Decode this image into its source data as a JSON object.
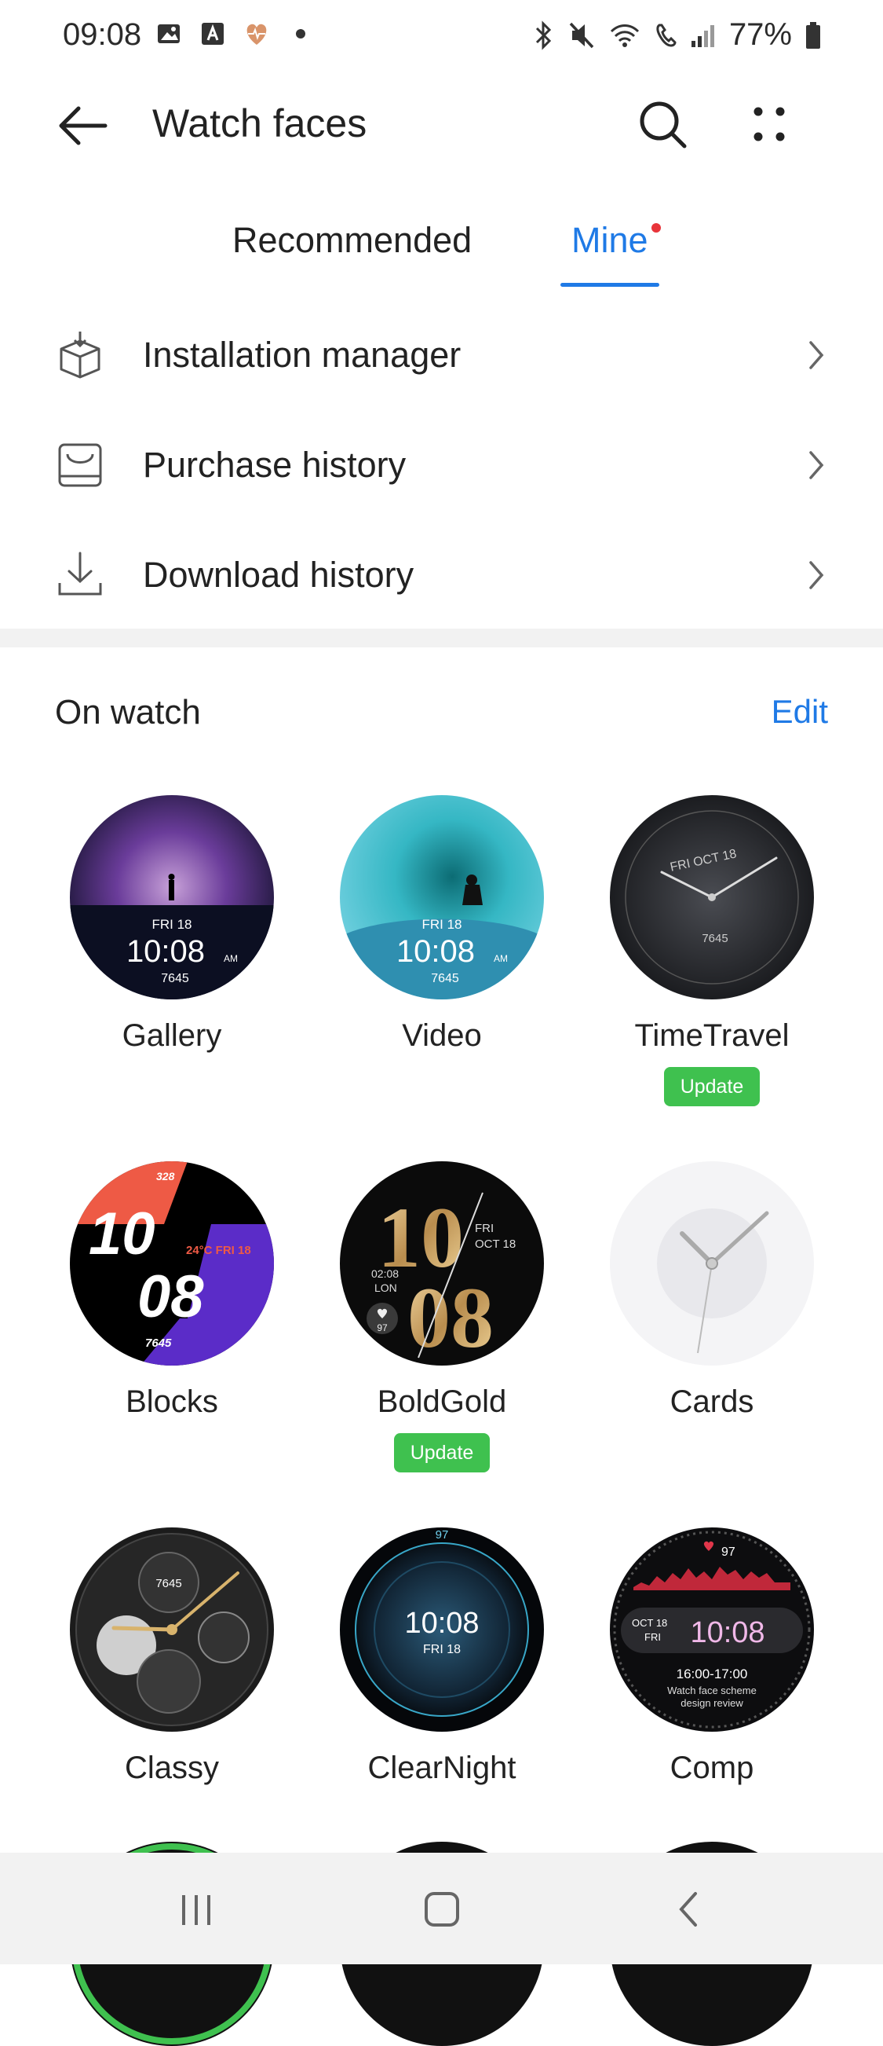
{
  "status_bar": {
    "time": "09:08",
    "battery": "77%",
    "left_icons": [
      "gallery-icon",
      "a-icon",
      "heart-icon",
      "dot-icon"
    ],
    "right_icons": [
      "bluetooth-icon",
      "mute-icon",
      "wifi-icon",
      "call-icon",
      "signal-icon",
      "battery-icon"
    ]
  },
  "app_bar": {
    "title": "Watch faces"
  },
  "tabs": [
    {
      "label": "Recommended",
      "selected": false
    },
    {
      "label": "Mine",
      "selected": true,
      "badge": true
    }
  ],
  "menu": [
    {
      "label": "Installation manager",
      "icon": "package-icon"
    },
    {
      "label": "Purchase history",
      "icon": "purchase-icon"
    },
    {
      "label": "Download history",
      "icon": "download-icon"
    }
  ],
  "on_watch": {
    "title": "On watch",
    "edit_label": "Edit",
    "update_label": "Update",
    "faces": [
      {
        "name": "Gallery",
        "date": "FRI 18",
        "time": "10:08",
        "ampm": "AM",
        "steps": "7645",
        "update": false
      },
      {
        "name": "Video",
        "date": "FRI 18",
        "time": "10:08",
        "ampm": "AM",
        "steps": "7645",
        "update": false
      },
      {
        "name": "TimeTravel",
        "date": "FRI OCT 18",
        "steps": "7645",
        "update": true
      },
      {
        "name": "Blocks",
        "hour": "10",
        "minute": "08",
        "calories": "328",
        "weather": "24°C FRI 18",
        "steps": "7645",
        "update": false
      },
      {
        "name": "BoldGold",
        "hour": "10",
        "minute": "08",
        "date_day": "FRI",
        "date": "OCT 18",
        "world_time": "02:08",
        "city": "LON",
        "heart": "97",
        "update": true
      },
      {
        "name": "Cards",
        "update": false
      },
      {
        "name": "Classy",
        "steps": "7645",
        "update": false
      },
      {
        "name": "ClearNight",
        "time": "10:08",
        "date": "FRI 18",
        "heart": "97",
        "update": false
      },
      {
        "name": "Comp",
        "time": "10:08",
        "date": "OCT 18",
        "day": "FRI",
        "heart": "97",
        "event_time": "16:00-17:00",
        "event_title": "Watch face scheme",
        "event_sub": "design review",
        "update": false
      }
    ]
  },
  "colors": {
    "accent": "#1f7ae6",
    "update": "#3fc14f",
    "badge": "#e8343a"
  }
}
